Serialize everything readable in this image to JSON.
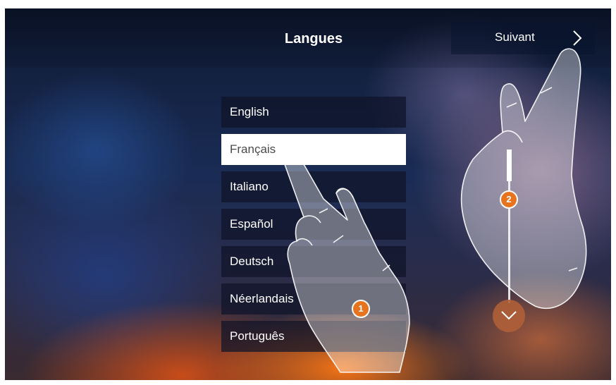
{
  "header": {
    "title": "Langues",
    "next_label": "Suivant",
    "next_icon": "chevron-right-icon"
  },
  "languages": {
    "items": [
      "English",
      "Français",
      "Italiano",
      "Español",
      "Deutsch",
      "Néerlandais",
      "Português"
    ],
    "selected": "Français"
  },
  "scroll": {
    "down_icon": "chevron-down-icon"
  },
  "callouts": [
    "1",
    "2"
  ],
  "colors": {
    "accent": "#e8731e",
    "selected_bg": "#ffffff",
    "item_bg": "#141a2c"
  }
}
